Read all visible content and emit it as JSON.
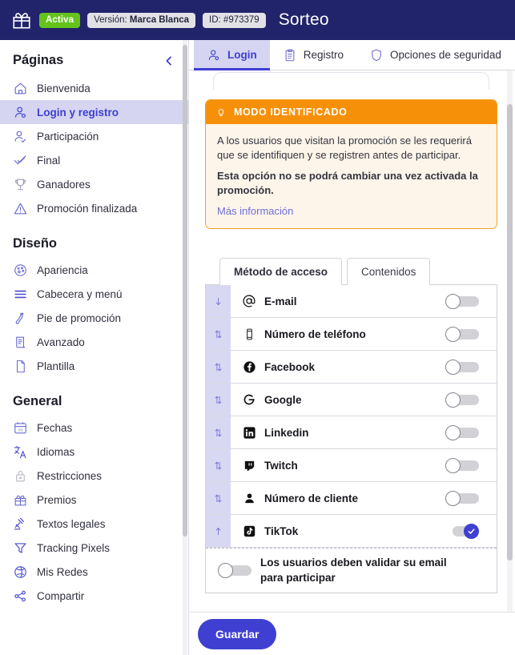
{
  "topbar": {
    "gift_icon": "gift-icon",
    "status_badge": "Activa",
    "version_prefix": "Versión: ",
    "version_value": "Marca Blanca",
    "id_badge": "ID: #973379",
    "title": "Sorteo",
    "colors": {
      "bar": "#22246b",
      "active": "#65c31b",
      "accent": "#3f3fd1"
    }
  },
  "sidebar": {
    "collapse_icon": "chevron-left-icon",
    "sections": [
      {
        "title": "Páginas",
        "items": [
          {
            "label": "Bienvenida",
            "icon": "home-icon",
            "active": false
          },
          {
            "label": "Login y registro",
            "icon": "user-login-icon",
            "active": true
          },
          {
            "label": "Participación",
            "icon": "user-add-icon",
            "active": false
          },
          {
            "label": "Final",
            "icon": "check-icon",
            "active": false
          },
          {
            "label": "Ganadores",
            "icon": "trophy-icon",
            "active": false
          },
          {
            "label": "Promoción finalizada",
            "icon": "warning-icon",
            "active": false
          }
        ]
      },
      {
        "title": "Diseño",
        "items": [
          {
            "label": "Apariencia",
            "icon": "palette-icon",
            "active": false
          },
          {
            "label": "Cabecera y menú",
            "icon": "menu-lines-icon",
            "active": false
          },
          {
            "label": "Pie de promoción",
            "icon": "footer-icon",
            "active": false
          },
          {
            "label": "Avanzado",
            "icon": "scroll-document-icon",
            "active": false
          },
          {
            "label": "Plantilla",
            "icon": "page-icon",
            "active": false
          }
        ]
      },
      {
        "title": "General",
        "items": [
          {
            "label": "Fechas",
            "icon": "calendar-icon",
            "active": false
          },
          {
            "label": "Idiomas",
            "icon": "translate-icon",
            "active": false
          },
          {
            "label": "Restricciones",
            "icon": "lock-icon",
            "active": false
          },
          {
            "label": "Premios",
            "icon": "gift-icon",
            "active": false
          },
          {
            "label": "Textos legales",
            "icon": "gavel-icon",
            "active": false
          },
          {
            "label": "Tracking Pixels",
            "icon": "funnel-icon",
            "active": false
          },
          {
            "label": "Mis Redes",
            "icon": "globe-icon",
            "active": false
          },
          {
            "label": "Compartir",
            "icon": "share-icon",
            "active": false
          }
        ]
      }
    ]
  },
  "main": {
    "tabs": [
      {
        "label": "Login",
        "icon": "user-login-icon",
        "active": true
      },
      {
        "label": "Registro",
        "icon": "clipboard-icon",
        "active": false
      },
      {
        "label": "Opciones de seguridad",
        "icon": "shield-icon",
        "active": false
      }
    ],
    "notice": {
      "icon": "lightbulb-icon",
      "title": "MODO IDENTIFICADO",
      "paragraph": "A los usuarios que visitan la promoción se les requerirá que se identifiquen y se registren antes de participar.",
      "paragraph_bold": "Esta opción no se podrá cambiar una vez activada la promoción.",
      "link": "Más información",
      "header_color": "#f79009",
      "body_color": "#fdf5ea"
    },
    "inner_tabs": [
      {
        "label": "Método de acceso",
        "active": true
      },
      {
        "label": "Contenidos",
        "active": false
      }
    ],
    "methods": [
      {
        "label": "E-mail",
        "icon": "at-sign-icon",
        "handle": "arrow-down-icon",
        "enabled": false
      },
      {
        "label": "Número de teléfono",
        "icon": "phone-icon",
        "handle": "arrows-updown-icon",
        "enabled": false
      },
      {
        "label": "Facebook",
        "icon": "facebook-icon",
        "handle": "arrows-updown-icon",
        "enabled": false
      },
      {
        "label": "Google",
        "icon": "google-icon",
        "handle": "arrows-updown-icon",
        "enabled": false
      },
      {
        "label": "Linkedin",
        "icon": "linkedin-icon",
        "handle": "arrows-updown-icon",
        "enabled": false
      },
      {
        "label": "Twitch",
        "icon": "twitch-icon",
        "handle": "arrows-updown-icon",
        "enabled": false
      },
      {
        "label": "Número de cliente",
        "icon": "person-filled-icon",
        "handle": "arrows-updown-icon",
        "enabled": false
      },
      {
        "label": "TikTok",
        "icon": "tiktok-icon",
        "handle": "arrow-up-icon",
        "enabled": true
      }
    ],
    "validate": {
      "label": "Los usuarios deben validar su email para participar",
      "enabled": false
    },
    "save_label": "Guardar"
  }
}
